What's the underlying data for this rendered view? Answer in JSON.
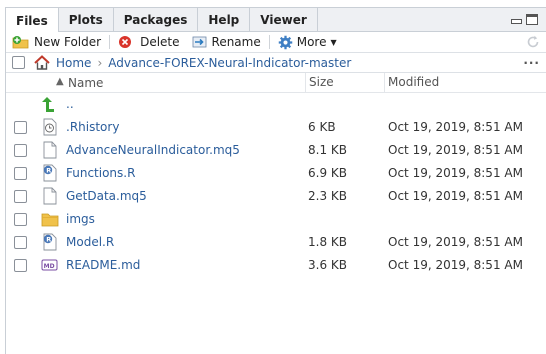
{
  "tabs": [
    {
      "label": "Files",
      "active": true
    },
    {
      "label": "Plots",
      "active": false
    },
    {
      "label": "Packages",
      "active": false
    },
    {
      "label": "Help",
      "active": false
    },
    {
      "label": "Viewer",
      "active": false
    }
  ],
  "toolbar": {
    "new_folder": "New Folder",
    "delete": "Delete",
    "rename": "Rename",
    "more": "More"
  },
  "breadcrumb": {
    "home": "Home",
    "folder": "Advance-FOREX-Neural-Indicator-master",
    "overflow": "..."
  },
  "columns": {
    "name": "Name",
    "name_sort_arrow": "▲",
    "size": "Size",
    "modified": "Modified"
  },
  "parent_label": "..",
  "files": [
    {
      "name": ".Rhistory",
      "size": "6 KB",
      "modified": "Oct 19, 2019, 8:51 AM",
      "icon": "rhistory-icon"
    },
    {
      "name": "AdvanceNeuralIndicator.mq5",
      "size": "8.1 KB",
      "modified": "Oct 19, 2019, 8:51 AM",
      "icon": "document-icon"
    },
    {
      "name": "Functions.R",
      "size": "6.9 KB",
      "modified": "Oct 19, 2019, 8:51 AM",
      "icon": "r-script-icon"
    },
    {
      "name": "GetData.mq5",
      "size": "2.3 KB",
      "modified": "Oct 19, 2019, 8:51 AM",
      "icon": "document-icon"
    },
    {
      "name": "imgs",
      "size": "",
      "modified": "",
      "icon": "folder-icon"
    },
    {
      "name": "Model.R",
      "size": "1.8 KB",
      "modified": "Oct 19, 2019, 8:51 AM",
      "icon": "r-script-icon"
    },
    {
      "name": "README.md",
      "size": "3.6 KB",
      "modified": "Oct 19, 2019, 8:51 AM",
      "icon": "markdown-icon"
    }
  ],
  "colors": {
    "link": "#2b5d9b",
    "folder": "#f0c24b",
    "up_arrow": "#3aa335",
    "delete": "#d9342b"
  }
}
